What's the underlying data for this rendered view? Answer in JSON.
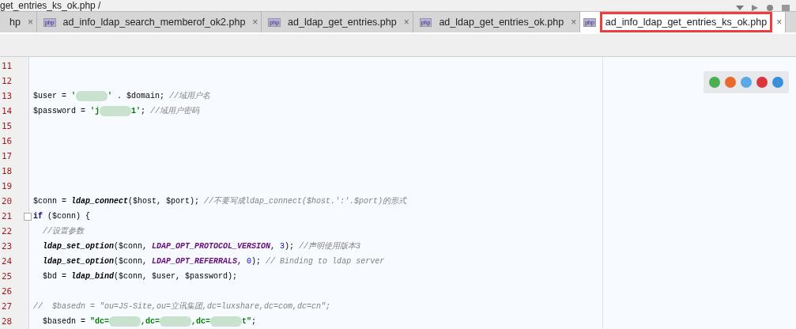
{
  "breadcrumb": "get_entries_ks_ok.php /",
  "tabs": [
    {
      "label": "hp",
      "close": "×",
      "selected": false
    },
    {
      "label": "ad_info_ldap_search_memberof_ok2.php",
      "close": "×",
      "selected": false,
      "file_icon": "php"
    },
    {
      "label": "ad_ldap_get_entries.php",
      "close": "×",
      "selected": false,
      "file_icon": "php"
    },
    {
      "label": "ad_ldap_get_entries_ok.php",
      "close": "×",
      "selected": false,
      "file_icon": "php"
    },
    {
      "label": "ad_info_ldap_get_entries_ks_ok.php",
      "close": "×",
      "selected": true,
      "file_icon": "php"
    }
  ],
  "lines": [
    {
      "n": "11"
    },
    {
      "n": "12"
    },
    {
      "n": "13",
      "indented": false,
      "tokens": [
        {
          "kind": "var",
          "text": "$user = "
        },
        {
          "kind": "string",
          "text": "'"
        },
        {
          "kind": "redacted"
        },
        {
          "kind": "string",
          "text": "'"
        },
        {
          "kind": "var",
          "text": " . $domain; "
        },
        {
          "kind": "comment",
          "text": "//域用户名"
        }
      ]
    },
    {
      "n": "14",
      "indented": false,
      "tokens": [
        {
          "kind": "var",
          "text": "$password = "
        },
        {
          "kind": "string",
          "text": "'j"
        },
        {
          "kind": "redacted"
        },
        {
          "kind": "string",
          "text": "1'"
        },
        {
          "kind": "var",
          "text": "; "
        },
        {
          "kind": "comment",
          "text": "//域用户密码"
        }
      ]
    },
    {
      "n": "15"
    },
    {
      "n": "16"
    },
    {
      "n": "17"
    },
    {
      "n": "18"
    },
    {
      "n": "19"
    },
    {
      "n": "20",
      "indented": false,
      "tokens": [
        {
          "kind": "var",
          "text": "$conn = "
        },
        {
          "kind": "func",
          "text": "ldap_connect"
        },
        {
          "kind": "var",
          "text": "($host, $port); "
        },
        {
          "kind": "comment",
          "text": "//不要写成ldap_connect($host.':'.$port)的形式"
        }
      ]
    },
    {
      "n": "21",
      "indented": false,
      "fold": true,
      "tokens": [
        {
          "kind": "keyword",
          "text": "if"
        },
        {
          "kind": "var",
          "text": " ($conn) {"
        }
      ]
    },
    {
      "n": "22",
      "indented": true,
      "tokens": [
        {
          "kind": "comment",
          "text": "//设置参数"
        }
      ]
    },
    {
      "n": "23",
      "indented": true,
      "tokens": [
        {
          "kind": "func",
          "text": "ldap_set_option"
        },
        {
          "kind": "var",
          "text": "($conn, "
        },
        {
          "kind": "const",
          "text": "LDAP_OPT_PROTOCOL_VERSION"
        },
        {
          "kind": "var",
          "text": ", "
        },
        {
          "kind": "number",
          "text": "3"
        },
        {
          "kind": "var",
          "text": "); "
        },
        {
          "kind": "comment",
          "text": "//声明使用版本3"
        }
      ]
    },
    {
      "n": "24",
      "indented": true,
      "tokens": [
        {
          "kind": "func",
          "text": "ldap_set_option"
        },
        {
          "kind": "var",
          "text": "($conn, "
        },
        {
          "kind": "const",
          "text": "LDAP_OPT_REFERRALS"
        },
        {
          "kind": "var",
          "text": ", "
        },
        {
          "kind": "number",
          "text": "0"
        },
        {
          "kind": "var",
          "text": "); "
        },
        {
          "kind": "comment",
          "text": "// Binding to ldap server"
        }
      ]
    },
    {
      "n": "25",
      "indented": true,
      "tokens": [
        {
          "kind": "var",
          "text": "$bd = "
        },
        {
          "kind": "func",
          "text": "ldap_bind"
        },
        {
          "kind": "var",
          "text": "($conn, $user, $password);"
        }
      ]
    },
    {
      "n": "26"
    },
    {
      "n": "27",
      "indented": false,
      "tokens": [
        {
          "kind": "comment",
          "text": "//  $basedn = \"ou=JS-Site,ou=立讯集团,dc=luxshare,dc=com,dc=cn\";"
        }
      ]
    },
    {
      "n": "28",
      "indented": true,
      "tokens": [
        {
          "kind": "var",
          "text": "$basedn = "
        },
        {
          "kind": "string",
          "text": "\"dc="
        },
        {
          "kind": "redacted"
        },
        {
          "kind": "string",
          "text": ",dc="
        },
        {
          "kind": "redacted"
        },
        {
          "kind": "string",
          "text": ",dc="
        },
        {
          "kind": "redacted"
        },
        {
          "kind": "string",
          "text": "t\""
        },
        {
          "kind": "var",
          "text": ";"
        }
      ]
    }
  ],
  "browsers": [
    {
      "color": "#4caf50"
    },
    {
      "color": "#e8692c"
    },
    {
      "color": "#5aa9e6"
    },
    {
      "color": "#d9363e"
    },
    {
      "color": "#3b8fd9"
    }
  ]
}
